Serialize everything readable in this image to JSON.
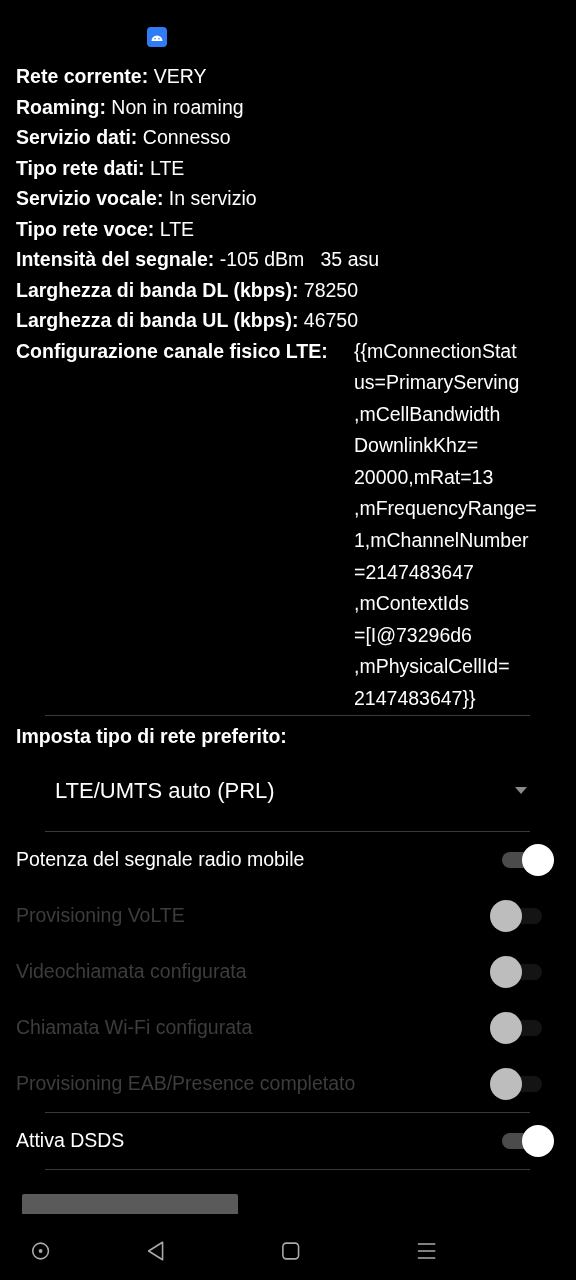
{
  "info_rows": [
    "**Rete corrente:** VERY",
    "**Roaming:** Non in roaming",
    "**Servizio dati:** Connesso",
    "**Tipo rete dati:** LTE",
    "**Servizio vocale:** In servizio",
    "**Tipo rete voce:** LTE",
    "**Intensità del segnale:** -105 dBm   35 asu",
    "**Larghezza di banda DL (kbps):** 78250",
    "**Larghezza di banda UL (kbps):** 46750"
  ],
  "physical_channel": {
    "label": "Configurazione canale fisico LTE:",
    "value_lines": [
      "{{mConnectionStat",
      "us=PrimaryServing",
      ",mCellBandwidth",
      "DownlinkKhz=",
      "20000,mRat=13",
      ",mFrequencyRange=",
      "1,mChannelNumber",
      "=2147483647",
      ",mContextIds",
      "=[I@73296d6",
      ",mPhysicalCellId=",
      "2147483647}}"
    ]
  },
  "preferred_network": {
    "label": "Imposta tipo di rete preferito:",
    "value": "LTE/UMTS auto (PRL)"
  },
  "toggle_groups": [
    [
      {
        "label": "Potenza del segnale radio mobile",
        "on": true,
        "disabled": false
      },
      {
        "label": "Provisioning VoLTE",
        "on": false,
        "disabled": true
      },
      {
        "label": "Videochiamata configurata",
        "on": false,
        "disabled": true
      },
      {
        "label": "Chiamata Wi-Fi configurata",
        "on": false,
        "disabled": true
      },
      {
        "label": "Provisioning EAB/Presence completato",
        "on": false,
        "disabled": true
      }
    ],
    [
      {
        "label": "Attiva DSDS",
        "on": true,
        "disabled": false
      }
    ]
  ]
}
